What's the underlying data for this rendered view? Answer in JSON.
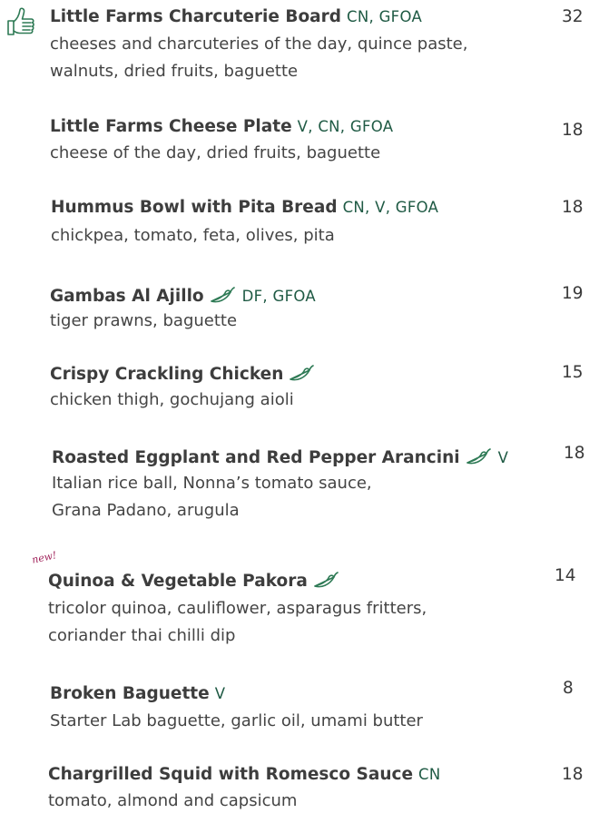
{
  "colors": {
    "tag": "#1f5a44",
    "new_mark": "#a0225a",
    "chilli": "#2e7a55"
  },
  "items": [
    {
      "name": "Little Farms Charcuterie Board",
      "tags": "CN, GFOA",
      "desc1": "cheeses and charcuteries of the day, quince paste,",
      "desc2": "walnuts, dried fruits, baguette",
      "price": "32",
      "icon": "thumbs-up-icon"
    },
    {
      "name": "Little Farms Cheese Plate",
      "tags": "V, CN, GFOA",
      "desc1": "cheese of the day, dried fruits, baguette",
      "price": "18"
    },
    {
      "name": "Hummus Bowl with Pita Bread",
      "tags": "CN, V, GFOA",
      "desc1": "chickpea, tomato, feta, olives, pita",
      "price": "18"
    },
    {
      "name": "Gambas Al Ajillo",
      "tags": "DF, GFOA",
      "desc1": "tiger prawns, baguette",
      "price": "19",
      "icon": "chilli-icon"
    },
    {
      "name": "Crispy Crackling Chicken",
      "tags": "",
      "desc1": "chicken thigh, gochujang aioli",
      "price": "15",
      "icon": "chilli-icon"
    },
    {
      "name": "Roasted Eggplant and Red Pepper Arancini",
      "tags": "V",
      "desc1": "Italian rice ball, Nonna’s tomato sauce,",
      "desc2": "Grana Padano, arugula",
      "price": "18",
      "icon": "chilli-icon"
    },
    {
      "name": "Quinoa & Vegetable Pakora",
      "tags": "",
      "badge": "new!",
      "desc1": "tricolor quinoa, cauliflower, asparagus fritters,",
      "desc2": "coriander thai chilli dip",
      "price": "14",
      "icon": "chilli-icon"
    },
    {
      "name": "Broken Baguette",
      "tags": "V",
      "desc1": "Starter Lab baguette, garlic oil,  umami butter",
      "price": "8"
    },
    {
      "name": "Chargrilled Squid with Romesco Sauce",
      "tags": "CN",
      "desc1": "tomato, almond and capsicum",
      "price": "18"
    }
  ]
}
